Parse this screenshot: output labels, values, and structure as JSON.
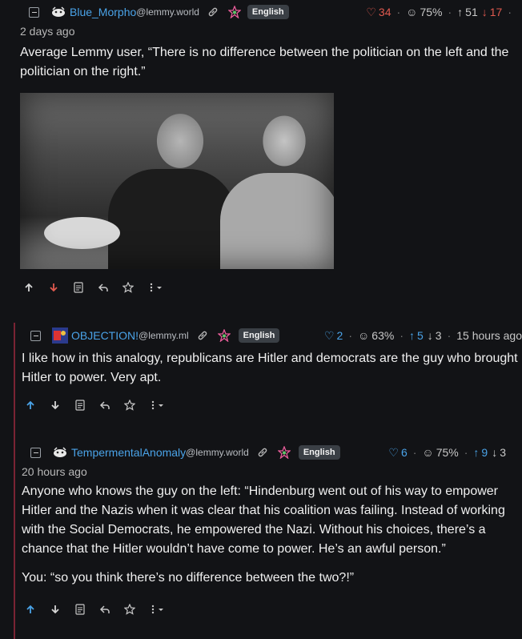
{
  "comments": [
    {
      "username": "Blue_Morpho",
      "instance": "@lemmy.world",
      "language": "English",
      "stats": {
        "hearts": "34",
        "percent": "75%",
        "up": "51",
        "down": "17"
      },
      "time": "2 days ago",
      "body": [
        "Average Lemmy user, “There is no difference between the politician on the left and the politician on the right.”"
      ]
    },
    {
      "username": "OBJECTION!",
      "instance": "@lemmy.ml",
      "language": "English",
      "stats": {
        "hearts": "2",
        "percent": "63%",
        "up": "5",
        "down": "3",
        "time": "15 hours ago"
      },
      "body": [
        "I like how in this analogy, republicans are Hitler and democrats are the guy who brought Hitler to power. Very apt."
      ]
    },
    {
      "username": "TempermentalAnomaly",
      "instance": "@lemmy.world",
      "language": "English",
      "stats": {
        "hearts": "6",
        "percent": "75%",
        "up": "9",
        "down": "3"
      },
      "time": "20 hours ago",
      "body": [
        "Anyone who knows the guy on the left: “Hindenburg went out of his way to empower Hitler and the Nazis when it was clear that his coalition was failing. Instead of working with the Social Democrats, he empowered the Nazi. Without his choices, there’s a chance that the Hitler wouldn’t have come to power. He’s an awful person.”",
        "You: “so you think there’s no difference between the two?!”"
      ]
    }
  ],
  "icons": [
    "collapse-icon",
    "link-icon",
    "ccc-icon",
    "heart-icon",
    "smile-icon",
    "arrow-up-icon",
    "arrow-down-icon",
    "source-icon",
    "reply-icon",
    "star-icon",
    "more-icon",
    "chevron-down-icon"
  ],
  "colors": {
    "accent": "#4aa3e8",
    "downvote": "#e05a4f",
    "thread_line": "#7a2333",
    "background": "#121316"
  }
}
